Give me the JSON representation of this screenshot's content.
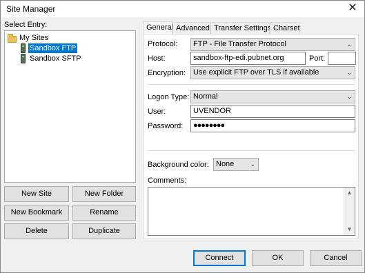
{
  "window": {
    "title": "Site Manager",
    "close_glyph": "✕"
  },
  "entry_label": "Select Entry:",
  "tree": {
    "root": {
      "label": "My Sites",
      "icon": "folder-icon"
    },
    "items": [
      {
        "label": "Sandbox FTP",
        "icon": "server-icon",
        "selected": true
      },
      {
        "label": "Sandbox SFTP",
        "icon": "server-icon",
        "selected": false
      }
    ]
  },
  "left_buttons": {
    "new_site": "New Site",
    "new_folder": "New Folder",
    "new_bookmark": "New Bookmark",
    "rename": "Rename",
    "delete": "Delete",
    "duplicate": "Duplicate"
  },
  "tabs": [
    {
      "label": "General",
      "active": true
    },
    {
      "label": "Advanced",
      "active": false
    },
    {
      "label": "Transfer Settings",
      "active": false
    },
    {
      "label": "Charset",
      "active": false
    }
  ],
  "general": {
    "protocol_label": "Protocol:",
    "protocol_value": "FTP - File Transfer Protocol",
    "host_label": "Host:",
    "host_value": "sandbox-ftp-edi.pubnet.org",
    "port_label": "Port:",
    "port_value": "",
    "encryption_label": "Encryption:",
    "encryption_value": "Use explicit FTP over TLS if available",
    "logon_label": "Logon Type:",
    "logon_value": "Normal",
    "user_label": "User:",
    "user_value": "UVENDOR",
    "password_label": "Password:",
    "password_value": "●●●●●●●●",
    "bgcolor_label": "Background color:",
    "bgcolor_value": "None",
    "comments_label": "Comments:",
    "comments_value": ""
  },
  "dropdown_arrow": "⌄",
  "footer": {
    "connect": "Connect",
    "ok": "OK",
    "cancel": "Cancel"
  },
  "colors": {
    "accent": "#0078d7",
    "window_bg": "#f0f0f0"
  }
}
